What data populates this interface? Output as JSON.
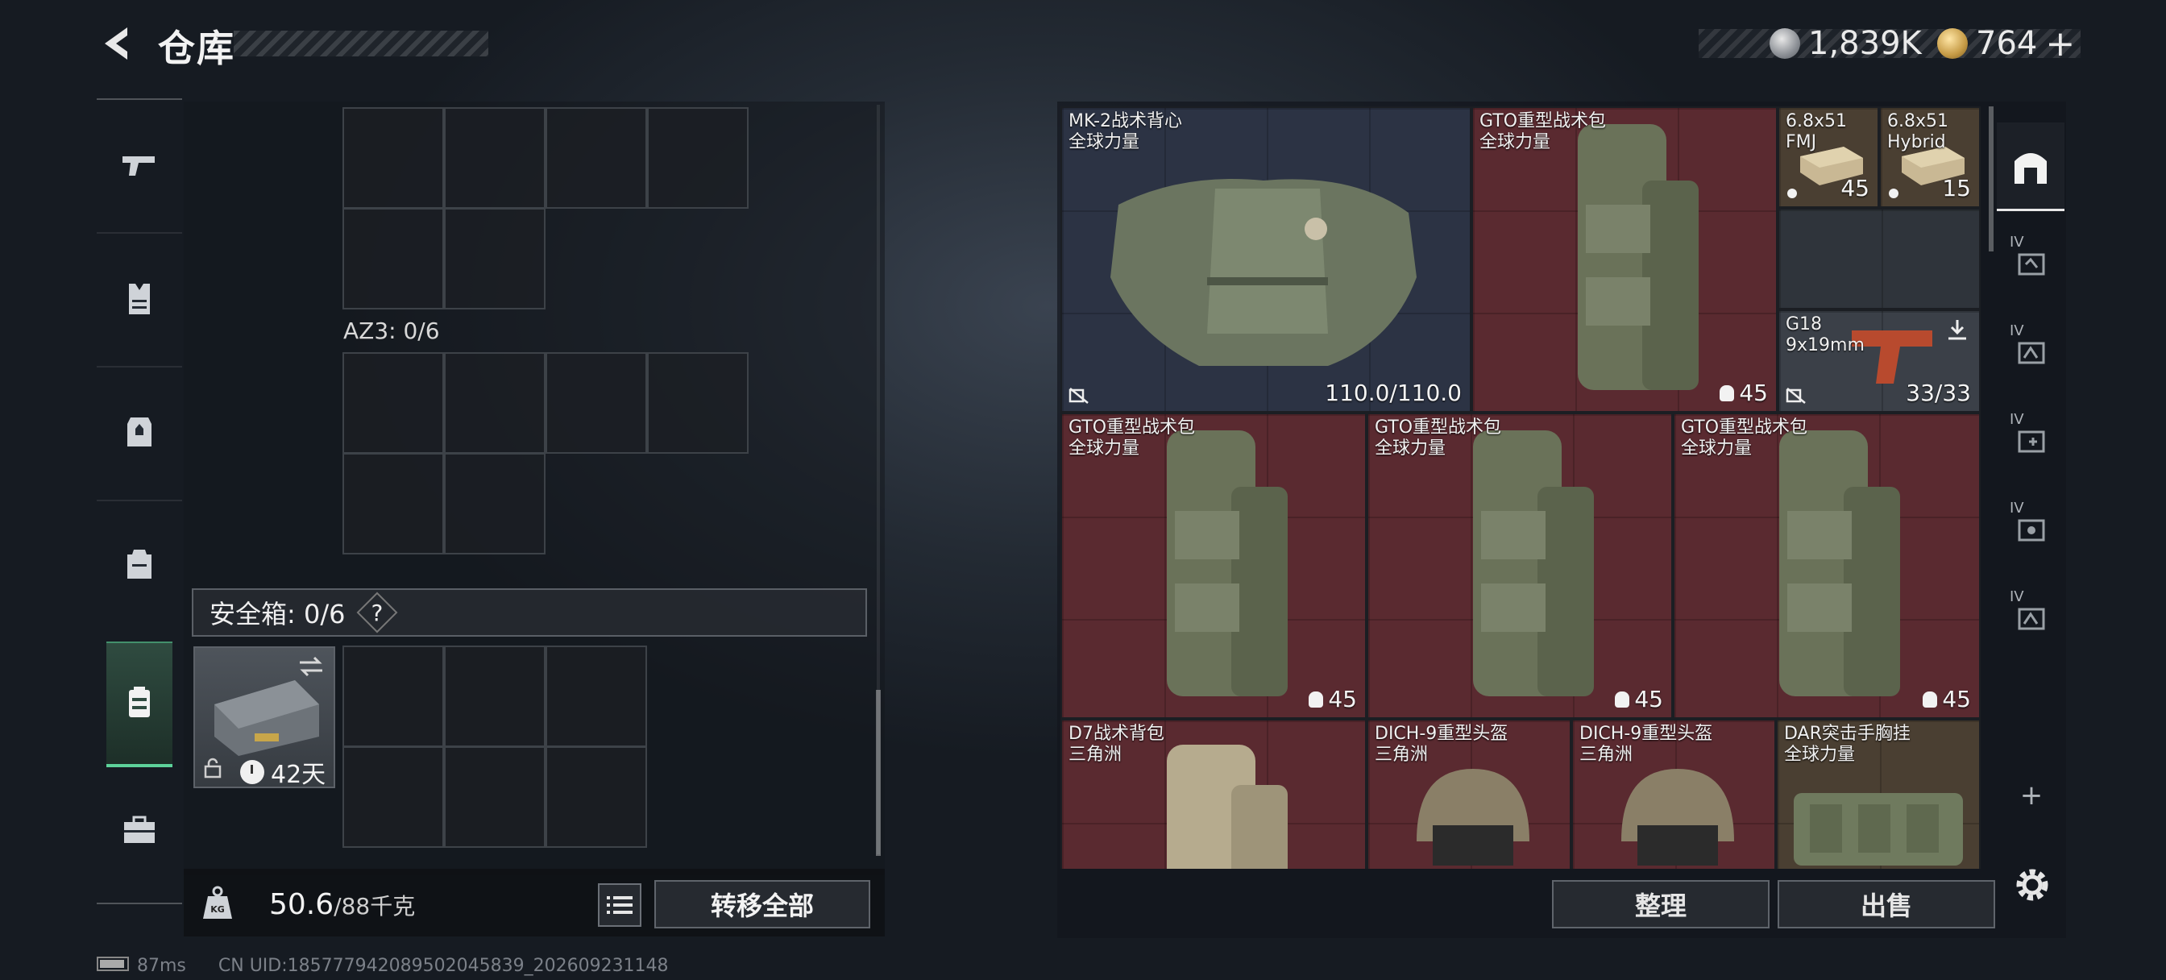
{
  "header": {
    "title": "仓库",
    "currency1": "1,839K",
    "currency2": "764",
    "currency2_plus": "+"
  },
  "left_nav": {
    "items": [
      "pistol-icon",
      "vest-icon",
      "chest-rig-icon",
      "backpack-icon",
      "safe-case-icon",
      "toolbox-icon"
    ],
    "active_index": 4
  },
  "storage": {
    "container_label": "AZ3: 0/6",
    "safe_label": "安全箱: 0/6",
    "safe_help": "?",
    "safe_days": "42天",
    "weight_value": "50.6",
    "weight_max": "/88千克",
    "transfer_label": "转移全部"
  },
  "items": [
    {
      "name": "MK-2战术背心",
      "sub": "全球力量",
      "value": "110.0/110.0"
    },
    {
      "name": "GTO重型战术包",
      "sub": "全球力量",
      "value": "45"
    },
    {
      "name": "6.8x51",
      "sub": "FMJ",
      "value": "45"
    },
    {
      "name": "6.8x51",
      "sub": "Hybrid",
      "value": "15"
    },
    {
      "name": "G18",
      "sub": "9x19mm",
      "value": "33/33"
    },
    {
      "name": "GTO重型战术包",
      "sub": "全球力量",
      "value": "45"
    },
    {
      "name": "GTO重型战术包",
      "sub": "全球力量",
      "value": "45"
    },
    {
      "name": "GTO重型战术包",
      "sub": "全球力量",
      "value": "45"
    },
    {
      "name": "D7战术背包",
      "sub": "三角洲"
    },
    {
      "name": "DICH-9重型头盔",
      "sub": "三角洲"
    },
    {
      "name": "DICH-9重型头盔",
      "sub": "三角洲"
    },
    {
      "name": "DAR突击手胸挂",
      "sub": "全球力量"
    }
  ],
  "right_sidebar": {
    "iv_label": "IV",
    "add": "+"
  },
  "actions": {
    "sort_label": "整理",
    "sell_label": "出售"
  },
  "footer": {
    "ping": "87ms",
    "uid": "CN UID:18577794208950204583​9_202609231148"
  },
  "colors": {
    "accent_green": "#5dd29a",
    "item_red": "#5a2a30",
    "item_blue": "#2c3344"
  }
}
